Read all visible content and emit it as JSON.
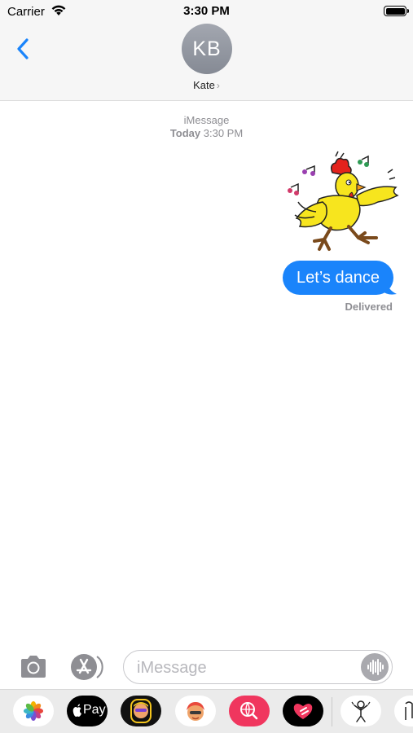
{
  "status_bar": {
    "carrier": "Carrier",
    "time": "3:30 PM"
  },
  "header": {
    "avatar_initials": "KB",
    "contact_name": "Kate",
    "chevron": "›"
  },
  "conversation": {
    "service": "iMessage",
    "timestamp_day": "Today",
    "timestamp_time": "3:30 PM",
    "sticker_icon": "dancing-chicken-sticker",
    "message_text": "Let’s dance",
    "delivery_status": "Delivered"
  },
  "input_bar": {
    "placeholder": "iMessage"
  },
  "drawer": {
    "apple_pay_label": "Pay"
  },
  "colors": {
    "accent": "#1a84fb",
    "bubble": "#1a84fb",
    "gray_text": "#8e8e93"
  }
}
